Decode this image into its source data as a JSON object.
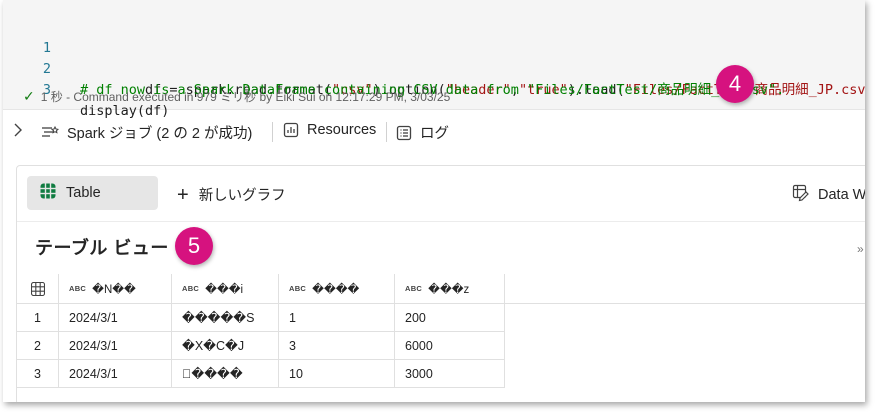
{
  "code": {
    "lines": [
      {
        "num": "1",
        "parts": [
          {
            "t": "df = spark.read.format(",
            "c": "def"
          },
          {
            "t": "\"csv\"",
            "c": "str"
          },
          {
            "t": ").option(",
            "c": "def"
          },
          {
            "t": "\"header\"",
            "c": "str"
          },
          {
            "t": ",",
            "c": "def"
          },
          {
            "t": "\"true\"",
            "c": "str"
          },
          {
            "t": ").load(",
            "c": "def"
          },
          {
            "t": "\"Files/FactTest/商品明細_JP.csv\"",
            "c": "str"
          },
          {
            "t": ")",
            "c": "def"
          }
        ]
      },
      {
        "num": "2",
        "parts": [
          {
            "t": "# df now is a Spark DataFrame containing CSV data from \"Files/FactTest/商品明細_JP.csv\".",
            "c": "com"
          }
        ]
      },
      {
        "num": "3",
        "parts": [
          {
            "t": "display(df)",
            "c": "def"
          }
        ]
      }
    ],
    "status": "1 秒 - Command executed in 979 ミリ秒 by Eiki Sui on 12:17:29 PM, 3/03/25"
  },
  "badges": {
    "four": "4",
    "five": "5"
  },
  "meta": {
    "spark_jobs": "Spark ジョブ (2 の 2 が成功)",
    "resources": "Resources",
    "log": "ログ"
  },
  "panel": {
    "table_tab": "Table",
    "new_graph": "新しいグラフ",
    "data_w": "Data W",
    "view_title": "テーブル ビュー",
    "collapse": "»"
  },
  "table": {
    "type_tag": "ABC",
    "columns": [
      "�N��",
      "���i",
      "����",
      "���z"
    ],
    "rows": [
      [
        "1",
        "2024/3/1",
        "�����S",
        "1",
        "200"
      ],
      [
        "2",
        "2024/3/1",
        "�X�C�J",
        "3",
        "6000"
      ],
      [
        "3",
        "2024/3/1",
        "\u0000����",
        "10",
        "3000"
      ]
    ]
  },
  "colors": {
    "badge": "#d6127f",
    "string": "#a31515",
    "comment": "#008000",
    "line_number": "#237893",
    "success": "#107c10"
  },
  "icons": [
    "check-icon",
    "chevron-right-icon",
    "spark-jobs-icon",
    "resources-icon",
    "log-icon",
    "table-icon",
    "plus-icon",
    "data-wrangler-icon",
    "grid-icon"
  ]
}
